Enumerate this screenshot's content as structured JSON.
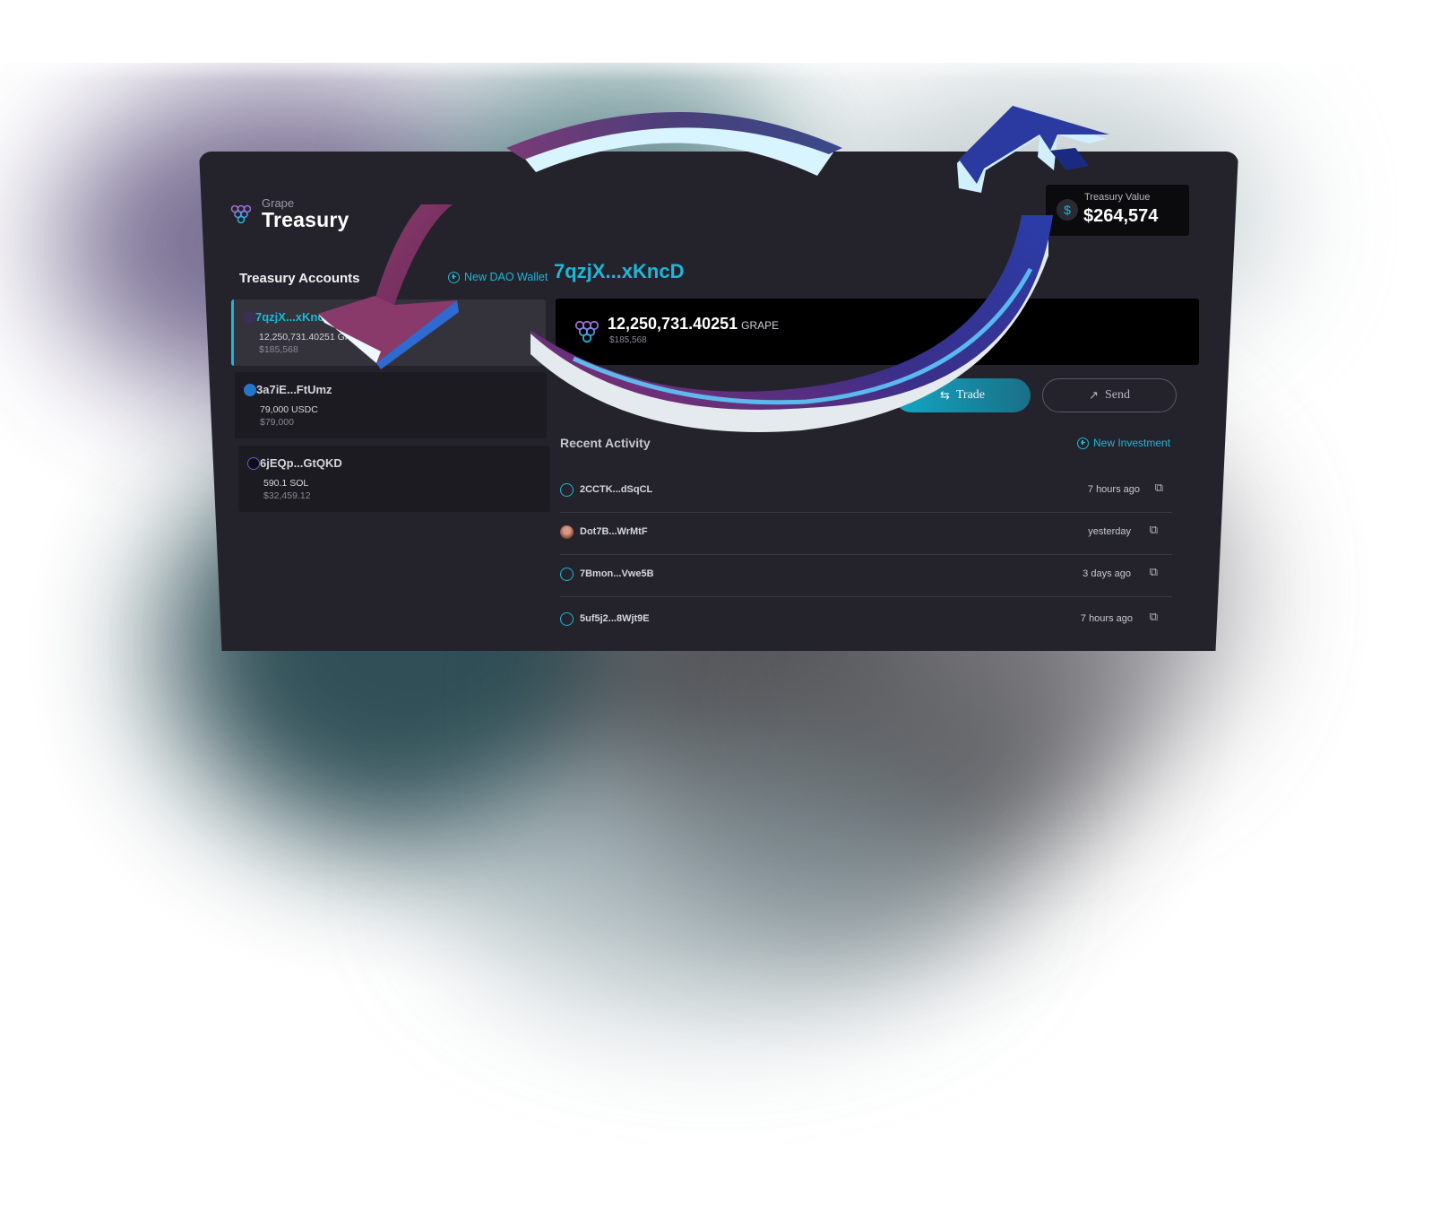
{
  "brand": {
    "sub": "Grape",
    "title": "Treasury"
  },
  "treasury_value": {
    "label": "Treasury Value",
    "value": "$264,574",
    "icon": "dollar-icon"
  },
  "accounts": {
    "title": "Treasury Accounts",
    "new_wallet_label": "New DAO Wallet",
    "items": [
      {
        "name": "7qzjX...xKncD",
        "amount": "12,250,731.40251 GRAPE",
        "usd": "$185,568",
        "icon": "grape-icon"
      },
      {
        "name": "3a7iE...FtUmz",
        "amount": "79,000 USDC",
        "usd": "$79,000",
        "icon": "usdc-icon"
      },
      {
        "name": "6jEQp...GtQKD",
        "amount": "590.1 SOL",
        "usd": "$32,459.12",
        "icon": "sol-icon"
      }
    ]
  },
  "wallet": {
    "title": "7qzjX...xKncD",
    "balance": "12,250,731.40251",
    "unit": "GRAPE",
    "balance_usd": "$185,568"
  },
  "actions": {
    "trade": "Trade",
    "send": "Send"
  },
  "activity": {
    "title": "Recent Activity",
    "new_label": "New Investment",
    "rows": [
      {
        "address": "2CCTK...dSqCL",
        "time": "7 hours ago"
      },
      {
        "address": "Dot7B...WrMtF",
        "time": "yesterday"
      },
      {
        "address": "7Bmon...Vwe5B",
        "time": "3 days ago"
      },
      {
        "address": "5uf5j2...8Wjt9E",
        "time": "7 hours ago"
      }
    ]
  },
  "colors": {
    "accent": "#1fb6d8",
    "panel": "#24232b",
    "arrow_magenta": "#8a3a78",
    "arrow_blue": "#2a3b9e"
  }
}
